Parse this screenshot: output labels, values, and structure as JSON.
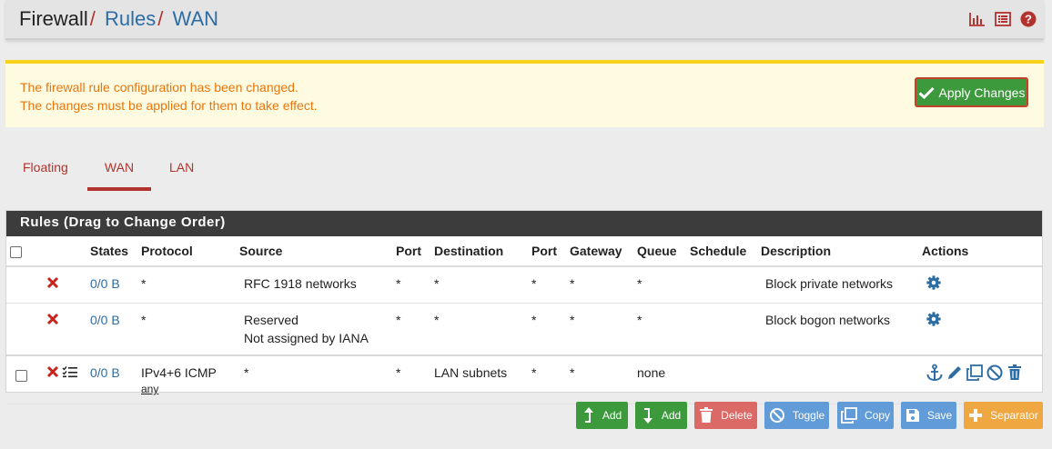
{
  "breadcrumb": {
    "root": "Firewall",
    "sep": "/",
    "items": [
      "Rules",
      "WAN"
    ]
  },
  "header_icons": [
    "chart-icon",
    "list-icon",
    "help-icon"
  ],
  "alert": {
    "line1": "The firewall rule configuration has been changed.",
    "line2": "The changes must be applied for them to take effect.",
    "apply_label": "Apply Changes"
  },
  "tabs": [
    {
      "label": "Floating"
    },
    {
      "label": "WAN",
      "active": true
    },
    {
      "label": "LAN"
    }
  ],
  "panel": {
    "title": "Rules (Drag to Change Order)",
    "columns": [
      "States",
      "Protocol",
      "Source",
      "Port",
      "Destination",
      "Port",
      "Gateway",
      "Queue",
      "Schedule",
      "Description",
      "Actions"
    ]
  },
  "rules": [
    {
      "states": "0/0 B",
      "protocol": "*",
      "source": "RFC 1918 networks",
      "source2": "",
      "sport": "*",
      "destination": "*",
      "dport": "*",
      "gateway": "*",
      "queue": "*",
      "schedule": "",
      "description": "Block private networks"
    },
    {
      "states": "0/0 B",
      "protocol": "*",
      "source": "Reserved",
      "source2": "Not assigned by IANA",
      "sport": "*",
      "destination": "*",
      "dport": "*",
      "gateway": "*",
      "queue": "*",
      "schedule": "",
      "description": "Block bogon networks"
    },
    {
      "states": "0/0 B",
      "protocol": "IPv4+6 ICMP",
      "protocol_sub": "any",
      "source": "*",
      "sport": "*",
      "destination": "LAN subnets",
      "dport": "*",
      "gateway": "*",
      "queue": "none",
      "schedule": "",
      "description": ""
    }
  ],
  "buttons": {
    "add_top": "Add",
    "add_bottom": "Add",
    "delete": "Delete",
    "toggle": "Toggle",
    "copy": "Copy",
    "save": "Save",
    "separator": "Separator"
  },
  "colors": {
    "accent_red": "#b2332d",
    "link_blue": "#2c6da5",
    "success_green": "#3c9a3c",
    "warning_orange": "#e8750e"
  }
}
